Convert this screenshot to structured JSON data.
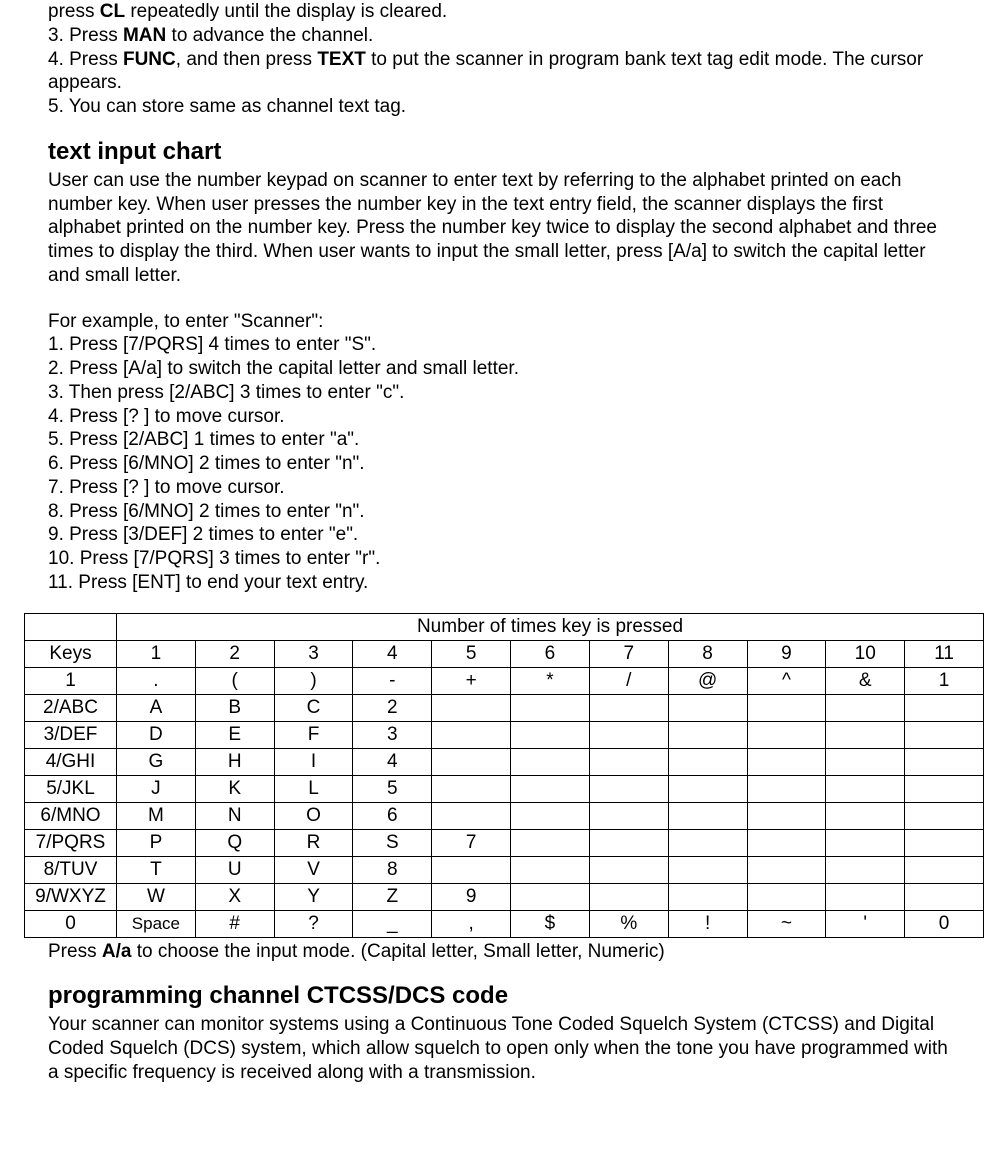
{
  "intro": {
    "line0_a": "press ",
    "line0_b": "CL",
    "line0_c": " repeatedly until the display is cleared.",
    "step3_a": "3. Press ",
    "step3_b": "MAN",
    "step3_c": " to advance the channel.",
    "step4_a": "4. Press ",
    "step4_b": "FUNC",
    "step4_c": ", and then press ",
    "step4_d": "TEXT",
    "step4_e": " to put the scanner in program bank text tag edit mode. The cursor appears.",
    "step5": "5. You can store same as channel text tag."
  },
  "section1": {
    "heading": "text input chart",
    "para": "User can use the number keypad on scanner to enter text by referring to the alphabet printed on each number key. When user presses the number key in the text entry field, the scanner displays the first alphabet printed on the number key. Press the number key twice to display the second alphabet and three times to display the third. When user wants to input the small letter, press [A/a] to switch the capital letter and small letter.",
    "example_lead": "For example, to enter \"Scanner\":",
    "steps": [
      "1. Press [7/PQRS] 4 times to enter \"S\".",
      "2. Press [A/a] to switch the capital letter and small letter.",
      "3. Then press [2/ABC] 3 times to enter \"c\".",
      "4. Press [? ] to move cursor.",
      "5. Press [2/ABC] 1 times to enter \"a\".",
      "6. Press [6/MNO] 2 times to enter \"n\".",
      "7. Press [? ] to move cursor.",
      "8. Press [6/MNO] 2 times to enter \"n\".",
      "9. Press [3/DEF] 2 times to enter \"e\".",
      "10. Press [7/PQRS] 3 times to enter \"r\".",
      "11. Press [ENT] to end your text entry."
    ]
  },
  "table": {
    "header_span": "Number of times key is pressed",
    "keys_label": "Keys",
    "col_headers": [
      "1",
      "2",
      "3",
      "4",
      "5",
      "6",
      "7",
      "8",
      "9",
      "10",
      "11"
    ],
    "rows": [
      {
        "key": "1",
        "cells": [
          ".",
          "(",
          ")",
          "-",
          "+",
          "*",
          "/",
          "@",
          "^",
          "&",
          "1"
        ]
      },
      {
        "key": "2/ABC",
        "cells": [
          "A",
          "B",
          "C",
          "2",
          "",
          "",
          "",
          "",
          "",
          "",
          ""
        ]
      },
      {
        "key": "3/DEF",
        "cells": [
          "D",
          "E",
          "F",
          "3",
          "",
          "",
          "",
          "",
          "",
          "",
          ""
        ]
      },
      {
        "key": "4/GHI",
        "cells": [
          "G",
          "H",
          "I",
          "4",
          "",
          "",
          "",
          "",
          "",
          "",
          ""
        ]
      },
      {
        "key": "5/JKL",
        "cells": [
          "J",
          "K",
          "L",
          "5",
          "",
          "",
          "",
          "",
          "",
          "",
          ""
        ]
      },
      {
        "key": "6/MNO",
        "cells": [
          "M",
          "N",
          "O",
          "6",
          "",
          "",
          "",
          "",
          "",
          "",
          ""
        ]
      },
      {
        "key": "7/PQRS",
        "cells": [
          "P",
          "Q",
          "R",
          "S",
          "7",
          "",
          "",
          "",
          "",
          "",
          ""
        ]
      },
      {
        "key": "8/TUV",
        "cells": [
          "T",
          "U",
          "V",
          "8",
          "",
          "",
          "",
          "",
          "",
          "",
          ""
        ]
      },
      {
        "key": "9/WXYZ",
        "cells": [
          "W",
          "X",
          "Y",
          "Z",
          "9",
          "",
          "",
          "",
          "",
          "",
          ""
        ]
      },
      {
        "key": "0",
        "cells": [
          "Space",
          "#",
          "?",
          "_",
          ",",
          "$",
          "%",
          "!",
          "~",
          "'",
          "0"
        ]
      }
    ]
  },
  "table_note_a": "Press ",
  "table_note_b": "A/a",
  "table_note_c": " to choose the input mode. (Capital letter, Small letter, Numeric)",
  "section2": {
    "heading": "programming channel CTCSS/DCS code",
    "para": "Your scanner can monitor systems using a Continuous Tone Coded Squelch System (CTCSS) and Digital Coded Squelch (DCS) system, which allow squelch to open only when the tone you have programmed with a specific frequency is received along with a transmission."
  }
}
